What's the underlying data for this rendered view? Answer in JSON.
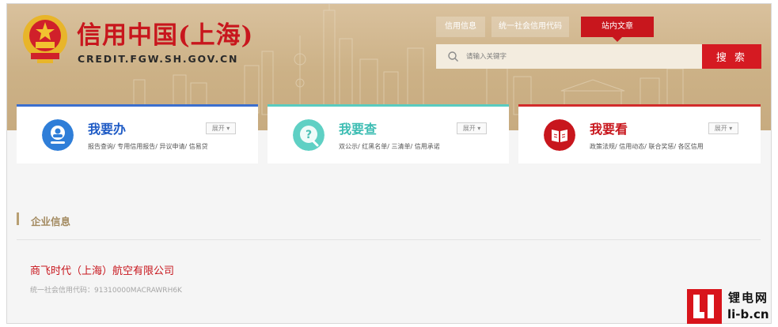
{
  "header": {
    "site_title": "信用中国(上海)",
    "site_domain": "CREDIT.FGW.SH.GOV.CN",
    "emblem_icon": "national-emblem-icon",
    "tabs": [
      {
        "label": "信用信息"
      },
      {
        "label": "统一社会信用代码"
      },
      {
        "label": "站内文章"
      }
    ],
    "search": {
      "placeholder": "请输入关键字",
      "button_label": "搜 索",
      "icon": "search-icon"
    }
  },
  "cards": [
    {
      "title": "我要办",
      "links": "报告查询/ 专用信用报告/ 异议申请/ 信易贷",
      "toggle": "展开 ▾",
      "icon": "person-badge-icon",
      "accent": "#1f5bc5"
    },
    {
      "title": "我要查",
      "links": "双公示/ 红黑名单/ 三清单/ 信用承诺",
      "toggle": "展开 ▾",
      "icon": "question-mark-icon",
      "accent": "#3dbdb3"
    },
    {
      "title": "我要看",
      "links": "政策法规/ 信用动态/ 联合奖惩/ 各区信用",
      "toggle": "展开 ▾",
      "icon": "open-book-icon",
      "accent": "#c8161d"
    }
  ],
  "section": {
    "title": "企业信息"
  },
  "company": {
    "name": "商飞时代（上海）航空有限公司",
    "credit_code": "统一社会信用代码：91310000MACRAWRH6K"
  },
  "watermark": {
    "logo_text": "LI",
    "cn_text": "锂电网",
    "url": "li-b.cn"
  },
  "colors": {
    "brand_red": "#c8161d",
    "banner_tan": "#cdb38a",
    "section_gold": "#a38a60"
  }
}
